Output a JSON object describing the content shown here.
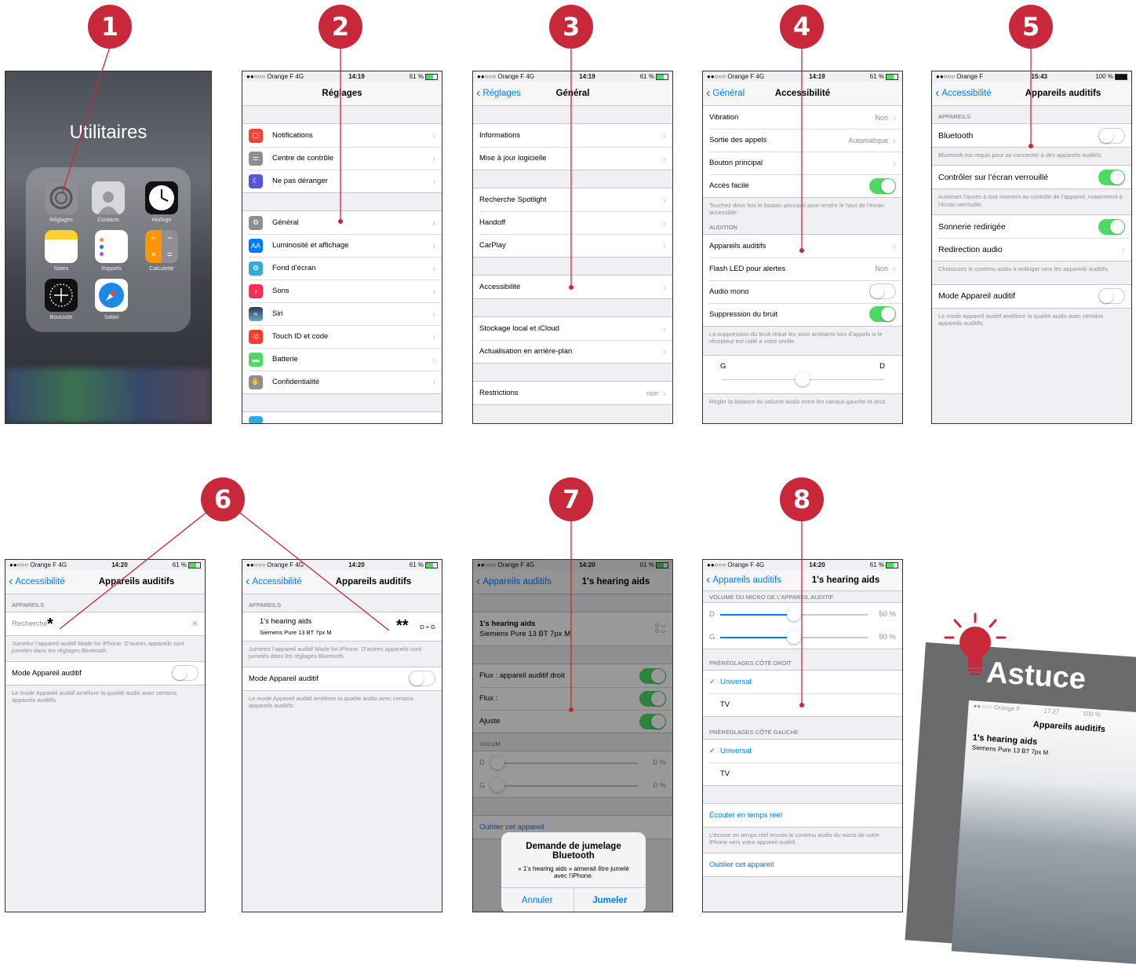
{
  "colors": {
    "accent": "#c8283a",
    "ios_blue": "#007aff",
    "ios_green": "#4cd964"
  },
  "badges": [
    "1",
    "2",
    "3",
    "4",
    "5",
    "6",
    "7",
    "8"
  ],
  "statusbar": {
    "carrier": "●●○○○ Orange F  4G",
    "carrier_wifi": "●●○○○ Orange F",
    "time_1419": "14:19",
    "time_1420": "14:20",
    "time_1543": "15:43",
    "time_1727": "17:27",
    "battery_61": "61 %",
    "battery_100": "100 %"
  },
  "s1": {
    "folder_title": "Utilitaires",
    "apps": [
      {
        "name": "Réglages",
        "icon": "settings-icon"
      },
      {
        "name": "Contacts",
        "icon": "contacts-icon"
      },
      {
        "name": "Horloge",
        "icon": "clock-icon"
      },
      {
        "name": "Notes",
        "icon": "notes-icon"
      },
      {
        "name": "Rappels",
        "icon": "reminders-icon"
      },
      {
        "name": "Calculette",
        "icon": "calculator-icon"
      },
      {
        "name": "Boussole",
        "icon": "compass-icon"
      },
      {
        "name": "Safari",
        "icon": "safari-icon"
      }
    ]
  },
  "s2": {
    "title": "Réglages",
    "group1": [
      {
        "label": "Notifications",
        "icon": "notifications-icon",
        "color": "#f44336"
      },
      {
        "label": "Centre de contrôle",
        "icon": "control-center-icon",
        "color": "#8e8e93"
      },
      {
        "label": "Ne pas déranger",
        "icon": "moon-icon",
        "color": "#5856d6"
      }
    ],
    "group2": [
      {
        "label": "Général",
        "icon": "gear-icon",
        "color": "#8e8e93"
      },
      {
        "label": "Luminosité et affichage",
        "icon": "brightness-icon",
        "color": "#007aff"
      },
      {
        "label": "Fond d’écran",
        "icon": "wallpaper-icon",
        "color": "#34aadc"
      },
      {
        "label": "Sons",
        "icon": "sound-icon",
        "color": "#ff2d55"
      },
      {
        "label": "Siri",
        "icon": "siri-icon",
        "color": "#333"
      },
      {
        "label": "Touch ID et code",
        "icon": "fingerprint-icon",
        "color": "#ff3b30"
      },
      {
        "label": "Batterie",
        "icon": "battery-icon",
        "color": "#4cd964"
      },
      {
        "label": "Confidentialité",
        "icon": "hand-icon",
        "color": "#8e8e93"
      }
    ]
  },
  "s3": {
    "back": "Réglages",
    "title": "Général",
    "g1": [
      "Informations",
      "Mise à jour logicielle"
    ],
    "g2": [
      "Recherche Spotlight",
      "Handoff",
      "CarPlay"
    ],
    "g3": [
      "Accessibilité"
    ],
    "g4": [
      "Stockage local et iCloud",
      "Actualisation en arrière-plan"
    ],
    "restrictions": "Restrictions",
    "restrictions_val": "non"
  },
  "s4": {
    "back": "Général",
    "title": "Accessibilité",
    "vibration": "Vibration",
    "vibration_val": "Non",
    "sortie": "Sortie des appels",
    "sortie_val": "Automatique",
    "bouton": "Bouton principal",
    "acces": "Accès facile",
    "acces_foot": "Touchez deux fois le bouton principal pour rendre le haut de l’écran accessible.",
    "audition_header": "AUDITION",
    "appareils": "Appareils auditifs",
    "flash": "Flash LED pour alertes",
    "flash_val": "Non",
    "mono": "Audio mono",
    "bruit": "Suppression du bruit",
    "bruit_foot": "La suppression du bruit réduit les sons ambiants lors d’appels si le récepteur est collé à votre oreille.",
    "left": "G",
    "right": "D",
    "balance": 0.5,
    "balance_foot": "Régler la balance du volume audio entre les canaux gauche et droit."
  },
  "s5": {
    "back": "Accessibilité",
    "title": "Appareils auditifs",
    "header": "APPAREILS",
    "bluetooth": "Bluetooth",
    "bt_foot": "Bluetooth est requis pour se connecter à des appareils auditifs.",
    "controler": "Contrôler sur l’écran verrouillé",
    "controler_foot": "Autoriser l’accès à tout moment au contrôle de l’appareil, notamment à l’écran verrouillé.",
    "sonnerie": "Sonnerie redirigée",
    "redirection": "Redirection audio",
    "redirection_foot": "Choisissez le contenu audio à rediriger vers les appareils auditifs.",
    "mode": "Mode Appareil auditif",
    "mode_foot": "Le mode Appareil auditif améliore la qualité audio avec certains appareils auditifs."
  },
  "s6a": {
    "back": "Accessibilité",
    "title": "Appareils auditifs",
    "header": "APPAREILS",
    "search": "Recherche",
    "foot": "Jumelez l’appareil auditif Made for iPhone. D’autres appareils sont jumelés dans les réglages Bluetooth.",
    "mode": "Mode Appareil auditif",
    "mode_foot": "Le mode Appareil auditif améliore la qualité audio avec certains appareils auditifs.",
    "star": "*"
  },
  "s6b": {
    "back": "Accessibilité",
    "title": "Appareils auditifs",
    "header": "APPAREILS",
    "device": "1's hearing aids",
    "model": "Siemens Pure 13 BT 7px M",
    "sides": "D + G",
    "foot": "Jumelez l’appareil auditif Made for iPhone. D’autres appareils sont jumelés dans les réglages Bluetooth.",
    "mode": "Mode Appareil auditif",
    "mode_foot": "Le mode Appareil auditif améliore la qualité audio avec certains appareils auditifs.",
    "star": "**"
  },
  "s7": {
    "back": "Appareils auditifs",
    "title": "1's hearing aids",
    "device": "1's hearing aids",
    "model": "Siemens Pure 13 BT 7px M",
    "bat_d": "D",
    "bat_g": "G",
    "flux_d": "Flux : appareil auditif droit",
    "flux_g": "Flux :",
    "ajust": "Ajuste",
    "vol_header": "VOLUM",
    "d": "D",
    "g": "G",
    "pct": "0 %",
    "oublier": "Oublier cet appareil",
    "alert_title": "Demande de jumelage Bluetooth",
    "alert_msg": "« 1's hearing aids » aimerait être jumelé avec l’iPhone.",
    "cancel": "Annuler",
    "pair": "Jumeler"
  },
  "s8": {
    "back": "Appareils auditifs",
    "title": "1's hearing aids",
    "mic_header": "VOLUME DU MICRO DE L’APPAREIL AUDITIF",
    "d": "D",
    "g": "G",
    "pct_d": "50 %",
    "pct_g": "50 %",
    "level_d": 0.5,
    "level_g": 0.5,
    "right_header": "PRÉRÉGLAGES CÔTÉ DROIT",
    "left_header": "PRÉRÉGLAGES CÔTÉ GAUCHE",
    "universal": "Universal",
    "tv": "TV",
    "live": "Écouter en temps réel",
    "live_foot": "L’écoute en temps réel envoie le contenu audio du micro de votre iPhone vers votre appareil auditif.",
    "oublier": "Oublier cet appareil"
  },
  "tip": {
    "title": "Astuce",
    "screen_title": "Appareils auditifs",
    "device": "1's hearing aids",
    "model": "Siemens Pure 13 BT 7px M"
  }
}
